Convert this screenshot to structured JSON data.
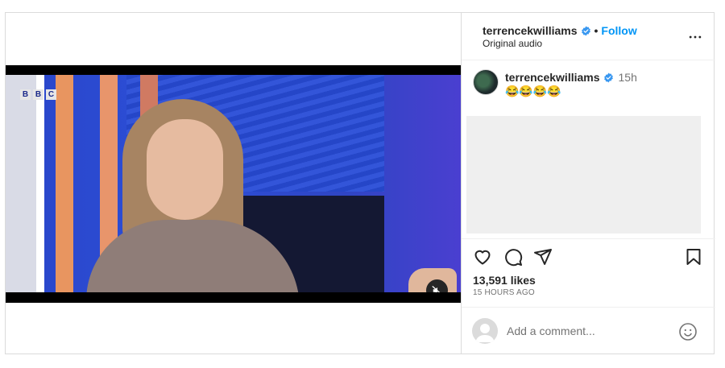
{
  "header": {
    "username": "terrencekwilliams",
    "follow_label": "Follow",
    "separator": "•",
    "audio": "Original audio"
  },
  "video": {
    "logo_letters": [
      "B",
      "B",
      "C"
    ],
    "muted": true
  },
  "caption": {
    "username": "terrencekwilliams",
    "time": "15h",
    "text": "😂😂😂😂"
  },
  "stats": {
    "likes": "13,591 likes",
    "posted": "15 HOURS AGO"
  },
  "comment": {
    "placeholder": "Add a comment..."
  },
  "icons": {
    "verified": "verified-badge-icon",
    "more": "more-options-icon",
    "like": "heart-icon",
    "comment": "comment-bubble-icon",
    "share": "paper-plane-icon",
    "save": "bookmark-icon",
    "emoji": "smiley-icon",
    "mute": "speaker-muted-icon"
  },
  "colors": {
    "accent": "#0095f6",
    "verified": "#3897f0",
    "text": "#262626",
    "muted_text": "#737373",
    "border": "#dbdbdb"
  }
}
